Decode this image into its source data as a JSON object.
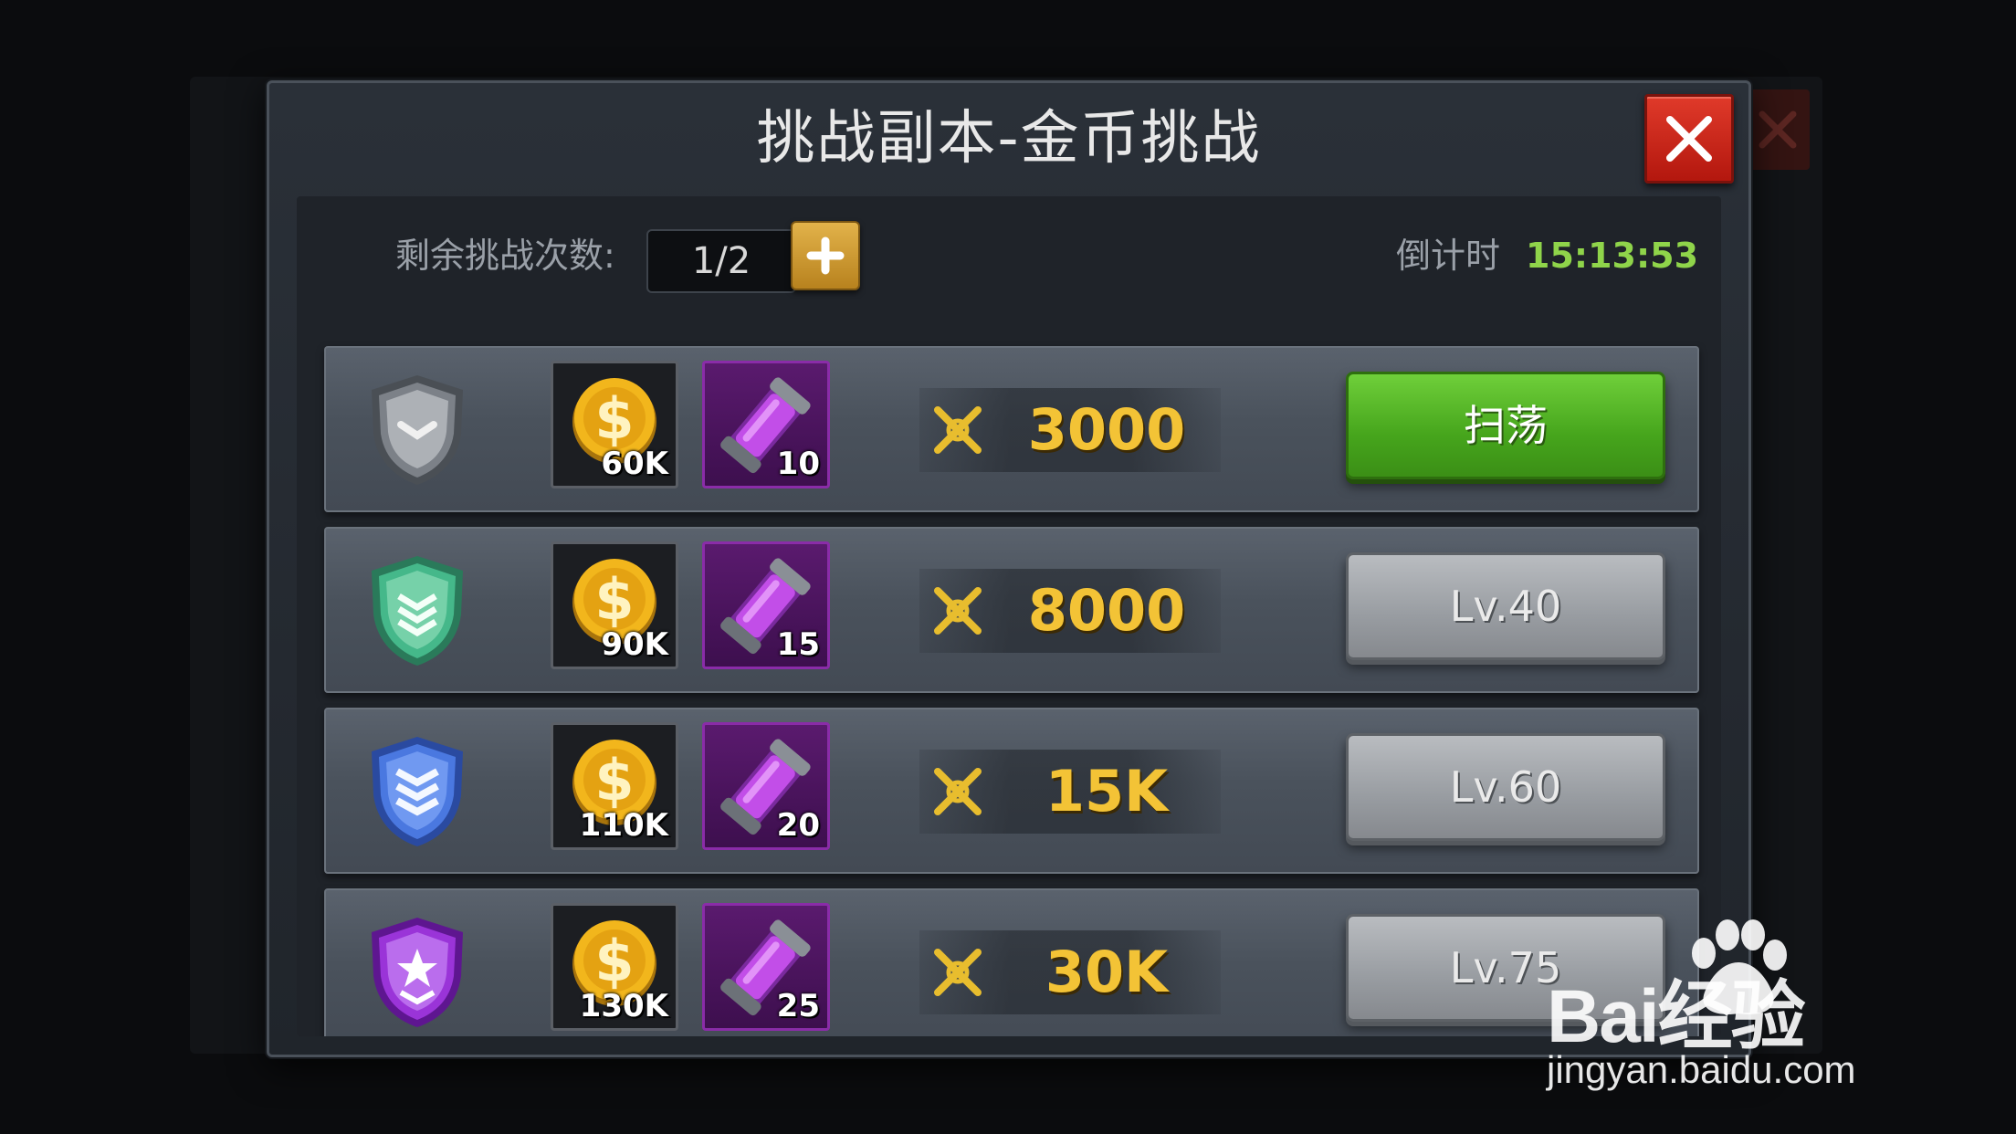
{
  "dialog": {
    "title": "挑战副本-金币挑战",
    "attempts_label": "剩余挑战次数:",
    "attempts_value": "1/2",
    "countdown_label": "倒计时",
    "countdown_value": "15:13:53"
  },
  "rows": [
    {
      "shield": "gray-shield-icon",
      "coin_qty": "60K",
      "tube_qty": "10",
      "reward": "3000",
      "action": "扫荡",
      "action_style": "green"
    },
    {
      "shield": "green-shield-icon",
      "coin_qty": "90K",
      "tube_qty": "15",
      "reward": "8000",
      "action": "Lv.40",
      "action_style": "gray"
    },
    {
      "shield": "blue-shield-icon",
      "coin_qty": "110K",
      "tube_qty": "20",
      "reward": "15K",
      "action": "Lv.60",
      "action_style": "gray"
    },
    {
      "shield": "purple-shield-icon",
      "coin_qty": "130K",
      "tube_qty": "25",
      "reward": "30K",
      "action": "Lv.75",
      "action_style": "gray"
    }
  ],
  "colors": {
    "close": "#d1281a",
    "countdown": "#8fd44a",
    "reward": "#f3c336",
    "sweep_button": "#4fae22",
    "locked_button": "#9ea1a6"
  },
  "watermark": {
    "brand": "Bai经验",
    "url": "jingyan.baidu.com"
  }
}
